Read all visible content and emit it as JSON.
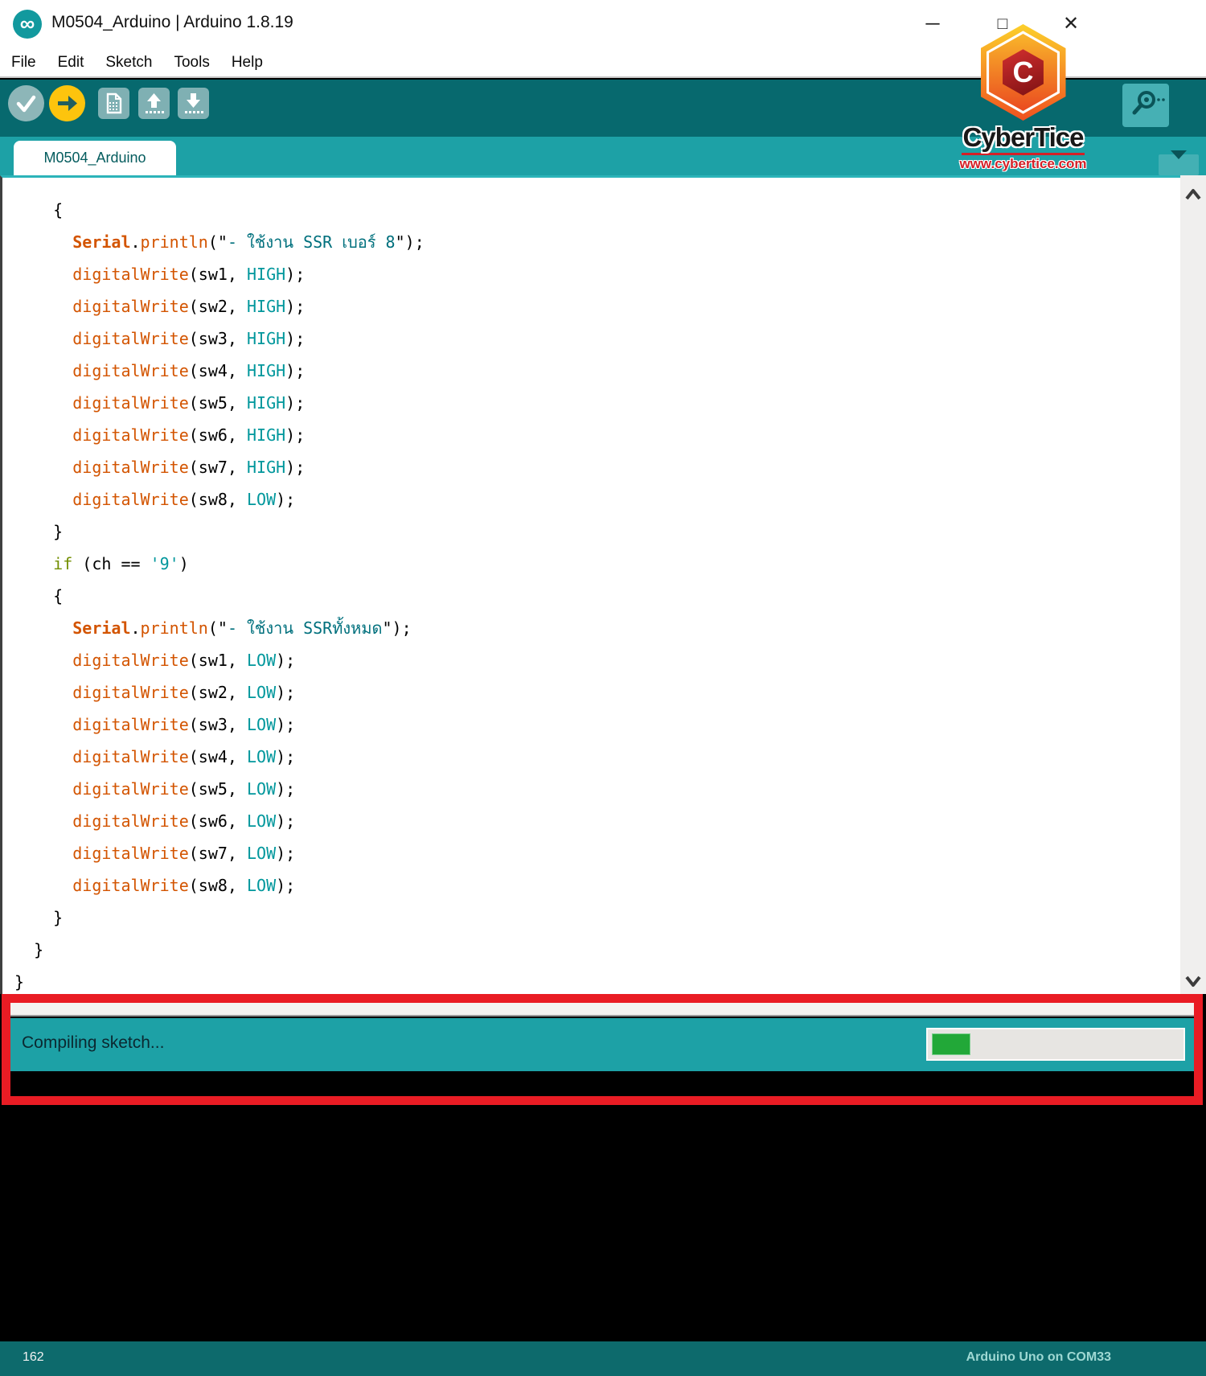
{
  "window": {
    "title": "M0504_Arduino | Arduino 1.8.19",
    "app_icon_glyph": "∞",
    "controls": {
      "minimize": "─",
      "maximize": "□",
      "close": "✕"
    }
  },
  "menu": {
    "items": [
      "File",
      "Edit",
      "Sketch",
      "Tools",
      "Help"
    ]
  },
  "toolbar": {
    "buttons": [
      "verify",
      "upload",
      "new",
      "open",
      "save",
      "serial-monitor"
    ]
  },
  "tabs": {
    "active": "M0504_Arduino"
  },
  "editor": {
    "lines": [
      [
        [
          "p",
          "    {"
        ]
      ],
      [
        [
          "p",
          "      "
        ],
        [
          "fnb",
          "Serial"
        ],
        [
          "p",
          "."
        ],
        [
          "fn",
          "println"
        ],
        [
          "p",
          "(\""
        ],
        [
          "str",
          "- ใช้งาน SSR เบอร์ 8"
        ],
        [
          "p",
          "\");"
        ]
      ],
      [
        [
          "p",
          "      "
        ],
        [
          "fn",
          "digitalWrite"
        ],
        [
          "p",
          "(sw1, "
        ],
        [
          "lit",
          "HIGH"
        ],
        [
          "p",
          ");"
        ]
      ],
      [
        [
          "p",
          "      "
        ],
        [
          "fn",
          "digitalWrite"
        ],
        [
          "p",
          "(sw2, "
        ],
        [
          "lit",
          "HIGH"
        ],
        [
          "p",
          ");"
        ]
      ],
      [
        [
          "p",
          "      "
        ],
        [
          "fn",
          "digitalWrite"
        ],
        [
          "p",
          "(sw3, "
        ],
        [
          "lit",
          "HIGH"
        ],
        [
          "p",
          ");"
        ]
      ],
      [
        [
          "p",
          "      "
        ],
        [
          "fn",
          "digitalWrite"
        ],
        [
          "p",
          "(sw4, "
        ],
        [
          "lit",
          "HIGH"
        ],
        [
          "p",
          ");"
        ]
      ],
      [
        [
          "p",
          "      "
        ],
        [
          "fn",
          "digitalWrite"
        ],
        [
          "p",
          "(sw5, "
        ],
        [
          "lit",
          "HIGH"
        ],
        [
          "p",
          ");"
        ]
      ],
      [
        [
          "p",
          "      "
        ],
        [
          "fn",
          "digitalWrite"
        ],
        [
          "p",
          "(sw6, "
        ],
        [
          "lit",
          "HIGH"
        ],
        [
          "p",
          ");"
        ]
      ],
      [
        [
          "p",
          "      "
        ],
        [
          "fn",
          "digitalWrite"
        ],
        [
          "p",
          "(sw7, "
        ],
        [
          "lit",
          "HIGH"
        ],
        [
          "p",
          ");"
        ]
      ],
      [
        [
          "p",
          "      "
        ],
        [
          "fn",
          "digitalWrite"
        ],
        [
          "p",
          "(sw8, "
        ],
        [
          "lit",
          "LOW"
        ],
        [
          "p",
          ");"
        ]
      ],
      [
        [
          "p",
          "    }"
        ]
      ],
      [
        [
          "p",
          "    "
        ],
        [
          "kw",
          "if"
        ],
        [
          "p",
          " (ch == "
        ],
        [
          "lit",
          "'9'"
        ],
        [
          "p",
          ")"
        ]
      ],
      [
        [
          "p",
          "    {"
        ]
      ],
      [
        [
          "p",
          "      "
        ],
        [
          "fnb",
          "Serial"
        ],
        [
          "p",
          "."
        ],
        [
          "fn",
          "println"
        ],
        [
          "p",
          "(\""
        ],
        [
          "str",
          "- ใช้งาน SSRทั้งหมด"
        ],
        [
          "p",
          "\");"
        ]
      ],
      [
        [
          "p",
          "      "
        ],
        [
          "fn",
          "digitalWrite"
        ],
        [
          "p",
          "(sw1, "
        ],
        [
          "lit",
          "LOW"
        ],
        [
          "p",
          ");"
        ]
      ],
      [
        [
          "p",
          "      "
        ],
        [
          "fn",
          "digitalWrite"
        ],
        [
          "p",
          "(sw2, "
        ],
        [
          "lit",
          "LOW"
        ],
        [
          "p",
          ");"
        ]
      ],
      [
        [
          "p",
          "      "
        ],
        [
          "fn",
          "digitalWrite"
        ],
        [
          "p",
          "(sw3, "
        ],
        [
          "lit",
          "LOW"
        ],
        [
          "p",
          ");"
        ]
      ],
      [
        [
          "p",
          "      "
        ],
        [
          "fn",
          "digitalWrite"
        ],
        [
          "p",
          "(sw4, "
        ],
        [
          "lit",
          "LOW"
        ],
        [
          "p",
          ");"
        ]
      ],
      [
        [
          "p",
          "      "
        ],
        [
          "fn",
          "digitalWrite"
        ],
        [
          "p",
          "(sw5, "
        ],
        [
          "lit",
          "LOW"
        ],
        [
          "p",
          ");"
        ]
      ],
      [
        [
          "p",
          "      "
        ],
        [
          "fn",
          "digitalWrite"
        ],
        [
          "p",
          "(sw6, "
        ],
        [
          "lit",
          "LOW"
        ],
        [
          "p",
          ");"
        ]
      ],
      [
        [
          "p",
          "      "
        ],
        [
          "fn",
          "digitalWrite"
        ],
        [
          "p",
          "(sw7, "
        ],
        [
          "lit",
          "LOW"
        ],
        [
          "p",
          ");"
        ]
      ],
      [
        [
          "p",
          "      "
        ],
        [
          "fn",
          "digitalWrite"
        ],
        [
          "p",
          "(sw8, "
        ],
        [
          "lit",
          "LOW"
        ],
        [
          "p",
          ");"
        ]
      ],
      [
        [
          "p",
          "    }"
        ]
      ],
      [
        [
          "p",
          "  }"
        ]
      ],
      [
        [
          "p",
          "}"
        ]
      ]
    ]
  },
  "status": {
    "message": "Compiling sketch...",
    "progress_percent": 15
  },
  "footer": {
    "line_number": "162",
    "board_info": "Arduino Uno on COM33"
  },
  "watermark": {
    "name": "CyberTice",
    "url": "www.cybertice.com",
    "monogram": "C"
  },
  "colors": {
    "toolbar-teal": "#07696e",
    "tab-teal": "#1da1a6",
    "status-teal": "#1da1a6",
    "footer-teal": "#0d6a6c",
    "highlight-red": "#e91c24",
    "progress-green": "#22a838",
    "accent-orange": "#d35400",
    "keyword-olive": "#728E00",
    "literal-teal": "#00979C",
    "string-teal": "#00707d"
  }
}
